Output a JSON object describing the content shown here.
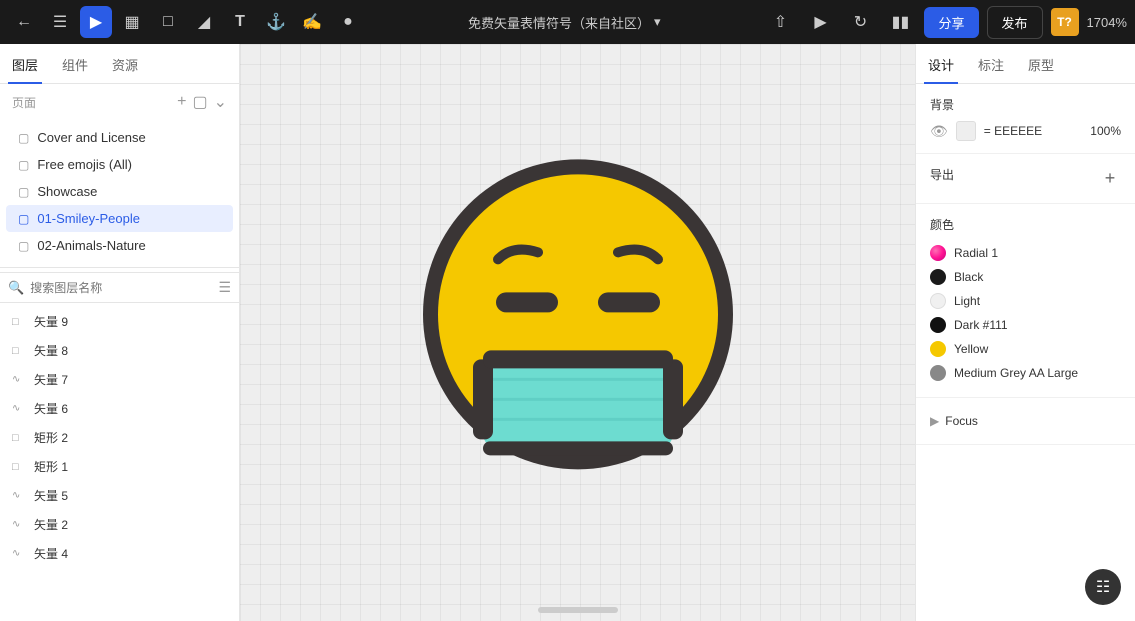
{
  "toolbar": {
    "title": "免费矢量表情符号（来自社区）",
    "title_dropdown": "▾",
    "share_label": "分享",
    "publish_label": "发布",
    "user_initials": "T?",
    "zoom_label": "1704%"
  },
  "left_panel": {
    "tabs": [
      {
        "id": "layers",
        "label": "图层"
      },
      {
        "id": "components",
        "label": "组件"
      },
      {
        "id": "assets",
        "label": "资源"
      }
    ],
    "section_title": "页面",
    "pages": [
      {
        "id": "cover",
        "label": "Cover and License"
      },
      {
        "id": "free-emojis",
        "label": "Free emojis (All)"
      },
      {
        "id": "showcase",
        "label": "Showcase"
      },
      {
        "id": "01-smiley",
        "label": "01-Smiley-People",
        "active": true
      },
      {
        "id": "02-animals",
        "label": "02-Animals-Nature"
      }
    ],
    "search_placeholder": "搜索图层名称",
    "layers": [
      {
        "id": "vec9",
        "label": "矢量 9",
        "icon": "□"
      },
      {
        "id": "vec8",
        "label": "矢量 8",
        "icon": "□"
      },
      {
        "id": "vec7",
        "label": "矢量 7",
        "icon": "⌒"
      },
      {
        "id": "vec6",
        "label": "矢量 6",
        "icon": "⌒"
      },
      {
        "id": "rect2",
        "label": "矩形 2",
        "icon": "□"
      },
      {
        "id": "rect1",
        "label": "矩形 1",
        "icon": "□"
      },
      {
        "id": "vec5",
        "label": "矢量 5",
        "icon": "⌒"
      },
      {
        "id": "vec2",
        "label": "矢量 2",
        "icon": "⌒"
      },
      {
        "id": "vec4",
        "label": "矢量 4",
        "icon": "⌒"
      }
    ]
  },
  "right_panel": {
    "tabs": [
      {
        "id": "design",
        "label": "设计",
        "active": true
      },
      {
        "id": "mark",
        "label": "标注"
      },
      {
        "id": "prototype",
        "label": "原型"
      }
    ],
    "background": {
      "title": "背景",
      "color_hex": "EEEEEE",
      "opacity": "100%"
    },
    "export": {
      "title": "导出"
    },
    "colors": {
      "title": "颜色",
      "items": [
        {
          "id": "radial1",
          "name": "Radial 1",
          "type": "radial",
          "color": null
        },
        {
          "id": "black",
          "name": "Black",
          "color": "#1a1a1a"
        },
        {
          "id": "light",
          "name": "Light",
          "color": "#f0f0f0"
        },
        {
          "id": "dark111",
          "name": "Dark #111",
          "color": "#111111"
        },
        {
          "id": "yellow",
          "name": "Yellow",
          "color": "#f5c800"
        },
        {
          "id": "medgrey",
          "name": "Medium Grey AA Large",
          "color": "#888888"
        }
      ]
    },
    "focus": {
      "label": "Focus"
    }
  }
}
